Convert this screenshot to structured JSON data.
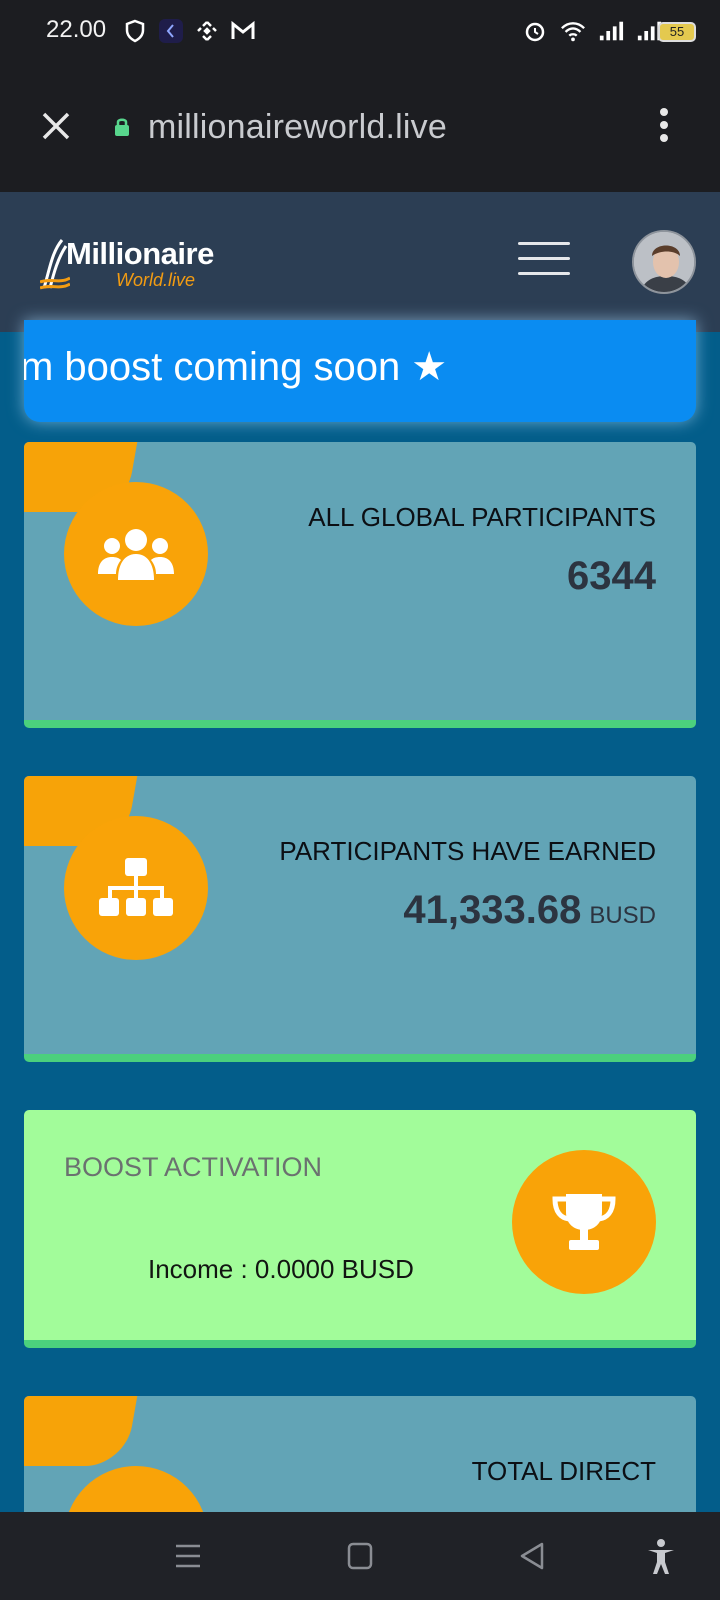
{
  "status_bar": {
    "time": "22.00",
    "battery": "55"
  },
  "browser": {
    "url": "millionaireworld.live"
  },
  "site": {
    "logo_main": "Millionaire",
    "logo_sub": "World.live"
  },
  "ticker": {
    "text": "m boost coming soon ★"
  },
  "cards": [
    {
      "title": "ALL GLOBAL PARTICIPANTS",
      "value": "6344",
      "unit": ""
    },
    {
      "title": "PARTICIPANTS HAVE EARNED",
      "value": "41,333.68",
      "unit": "BUSD"
    },
    {
      "title": "TOTAL DIRECT"
    }
  ],
  "boost": {
    "title": "BOOST ACTIVATION",
    "income": "Income : 0.0000 BUSD"
  },
  "colors": {
    "accent_orange": "#f9a308",
    "card_blue": "#62a4b6",
    "card_green": "#a2fc9a",
    "ticker_blue": "#0a8cf2",
    "page_bg": "#035d8a"
  }
}
